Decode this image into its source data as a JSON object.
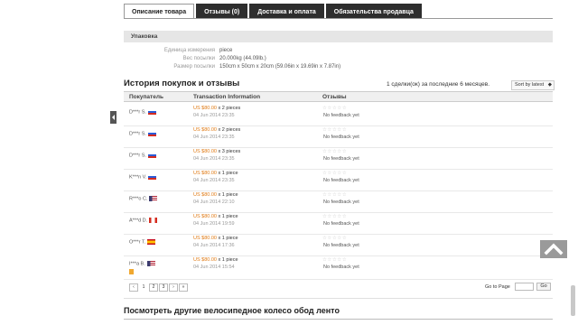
{
  "tabs": [
    {
      "label": "Описание товара",
      "active": true
    },
    {
      "label": "Отзывы (0)",
      "active": false
    },
    {
      "label": "Доставка и оплата",
      "active": false
    },
    {
      "label": "Обязательства продавца",
      "active": false
    }
  ],
  "packaging": {
    "header": "Упаковка",
    "specs": [
      {
        "key": "Единица измерения",
        "value": "piece"
      },
      {
        "key": "Вес посылки",
        "value": "20.000kg (44.09lb.)"
      },
      {
        "key": "Размер посылки",
        "value": "150cm x 50cm x 20cm (59.06in x 19.69in x 7.87in)"
      }
    ]
  },
  "history": {
    "title": "История покупок и отзывы",
    "deals_text": "1 сделки(ок) за последние 6 месяцев.",
    "sort_label": "Sort by latest",
    "columns": {
      "buyer": "Покупатель",
      "transaction": "Transaction Information",
      "feedback": "Отзывы"
    },
    "rows": [
      {
        "buyer": "D***r S.",
        "flag": "ru",
        "price": "US $80.00",
        "qty": "x 2 pieces",
        "date": "04 Jun 2014 23:35",
        "feedback": "No feedback yet"
      },
      {
        "buyer": "D***r S.",
        "flag": "ru",
        "price": "US $80.00",
        "qty": "x 2 pieces",
        "date": "04 Jun 2014 23:35",
        "feedback": "No feedback yet"
      },
      {
        "buyer": "D***r S.",
        "flag": "ru",
        "price": "US $80.00",
        "qty": "x 3 pieces",
        "date": "04 Jun 2014 23:35",
        "feedback": "No feedback yet"
      },
      {
        "buyer": "K***n V.",
        "flag": "ru",
        "price": "US $80.00",
        "qty": "x 1 piece",
        "date": "04 Jun 2014 23:35",
        "feedback": "No feedback yet"
      },
      {
        "buyer": "R***o C.",
        "flag": "us",
        "price": "US $80.00",
        "qty": "x 1 piece",
        "date": "04 Jun 2014 22:10",
        "feedback": "No feedback yet"
      },
      {
        "buyer": "A***d D.",
        "flag": "ca",
        "price": "US $80.00",
        "qty": "x 1 piece",
        "date": "04 Jun 2014 19:59",
        "feedback": "No feedback yet"
      },
      {
        "buyer": "O***r T.",
        "flag": "es",
        "price": "US $80.00",
        "qty": "x 1 piece",
        "date": "04 Jun 2014 17:36",
        "feedback": "No feedback yet"
      },
      {
        "buyer": "I***a B.",
        "flag": "us",
        "price": "US $80.00",
        "qty": "x 1 piece",
        "date": "04 Jun 2014 15:54",
        "feedback": "No feedback yet"
      }
    ]
  },
  "pagination": {
    "prev": "‹",
    "pages": [
      "1",
      "2",
      "3"
    ],
    "next": "›",
    "last": "»",
    "goto_label": "Go to Page",
    "go_button": "Go"
  },
  "bottom": {
    "title": "Посмотреть другие велосипедное колесо обод ленто"
  },
  "colors": {
    "price": "#e07a14",
    "tab_dark": "#2e2e2e"
  },
  "icons": {
    "scroll_top": "chevron-up-icon",
    "side_tab": "arrow-left-icon"
  }
}
